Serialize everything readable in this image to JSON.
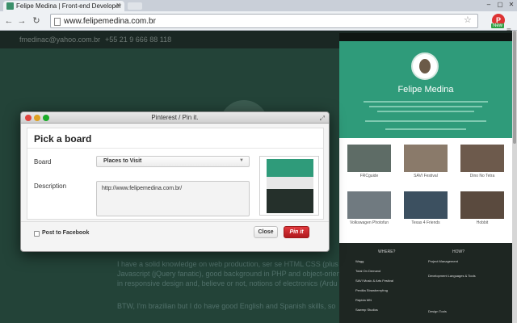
{
  "browser": {
    "tab_title": "Felipe Medina | Front-end Developer",
    "url": "www.felipemedina.com.br",
    "ext_badge": "New"
  },
  "page": {
    "email": "fmedinac@yahoo.com.br",
    "phone": "+55 21 9 666 88 118",
    "body_line1": "I have a solid knowledge on web production, ser se HTML CSS (plus LESS, SASS),",
    "body_line2": "Javascript (jQuery fanatic), good background in PHP and object-oriented proj",
    "body_line3": "in responsive design and, believe or not, notions of electronics (Ardu",
    "body_line4": "BTW, I'm brazilian but I do have good English and Spanish skills, so"
  },
  "preview": {
    "name": "Felipe Medina",
    "projects": [
      "FRCguide",
      "SAVI Festival",
      "Dino No Tetra",
      "Volkswagen Photofun",
      "Texas 4 Friends",
      "Hobbit"
    ],
    "where_heading": "WHERE?",
    "how_heading": "HOW?",
    "where_items": [
      "Wagg",
      "Total On Demand",
      "SAVI Music & Arts Festival",
      "Perdita Strawberryfrog",
      "Rápida MN",
      "Sawmp Studios"
    ],
    "how_items": [
      "Project Management",
      "Development Languages & Tools",
      "Design Tools"
    ]
  },
  "dialog": {
    "window_title": "Pinterest / Pin it.",
    "heading": "Pick a board",
    "board_label": "Board",
    "board_value": "Places to Visit",
    "description_label": "Description",
    "description_value": "http://www.felipemedina.com.br/",
    "post_facebook_label": "Post to Facebook",
    "close_label": "Close",
    "pin_label": "Pin it"
  },
  "colors": {
    "accent": "#2f9b7a",
    "pin_button": "#cb2027"
  }
}
